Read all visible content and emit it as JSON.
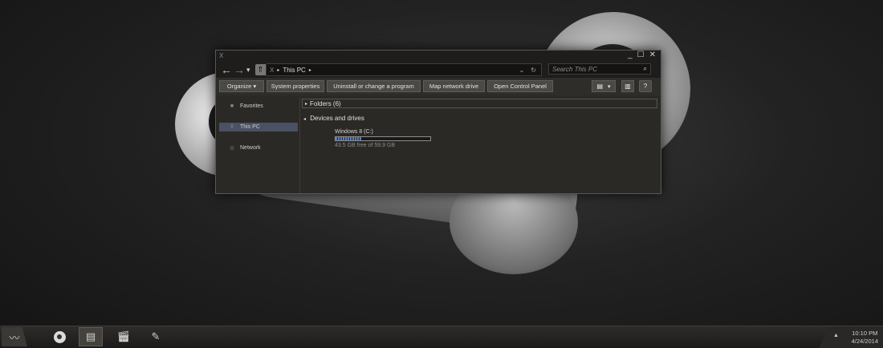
{
  "window": {
    "system_icon": "X",
    "controls": {
      "minimize": "_",
      "maximize": "☐",
      "close": "✕"
    },
    "nav": {
      "back": "←",
      "forward": "→",
      "dropdown": "▾",
      "up": "⇑"
    },
    "address": {
      "root_icon": "X",
      "separator": "▸",
      "location": "This PC",
      "chevron": "▸",
      "dropdown": "⌄",
      "refresh": "↻"
    },
    "search": {
      "placeholder": "Search This PC",
      "icon": "search-icon"
    },
    "toolbar": {
      "organize": "Organize ▾",
      "system_properties": "System properties",
      "uninstall": "Uninstall or change a program",
      "map_drive": "Map network drive",
      "control_panel": "Open Control Panel",
      "view_icon": "▤",
      "view_dropdown": "▾",
      "pane_icon": "▥",
      "help_icon": "?"
    },
    "navpane": {
      "items": [
        {
          "label": "Favorites",
          "icon": "■"
        },
        {
          "label": "This PC",
          "icon": "X"
        },
        {
          "label": "Network",
          "icon": "⊙"
        }
      ]
    },
    "content": {
      "group_folders": "Folders (6)",
      "group_folders_arrow": "▸",
      "group_devices": "Devices and drives",
      "group_devices_arrow": "◂",
      "drive": {
        "name": "Windows 8 (C:)",
        "free_text": "43.5 GB free of 59.9 GB",
        "used_fraction": 0.27
      }
    }
  },
  "taskbar": {
    "start_icon": "start-icon",
    "apps": [
      "steam-icon",
      "globe-icon",
      "file-explorer-icon",
      "clapperboard-icon",
      "pen-icon"
    ],
    "tray": {
      "up_arrow": "▲",
      "time": "10:10 PM",
      "date": "4/24/2014"
    }
  }
}
